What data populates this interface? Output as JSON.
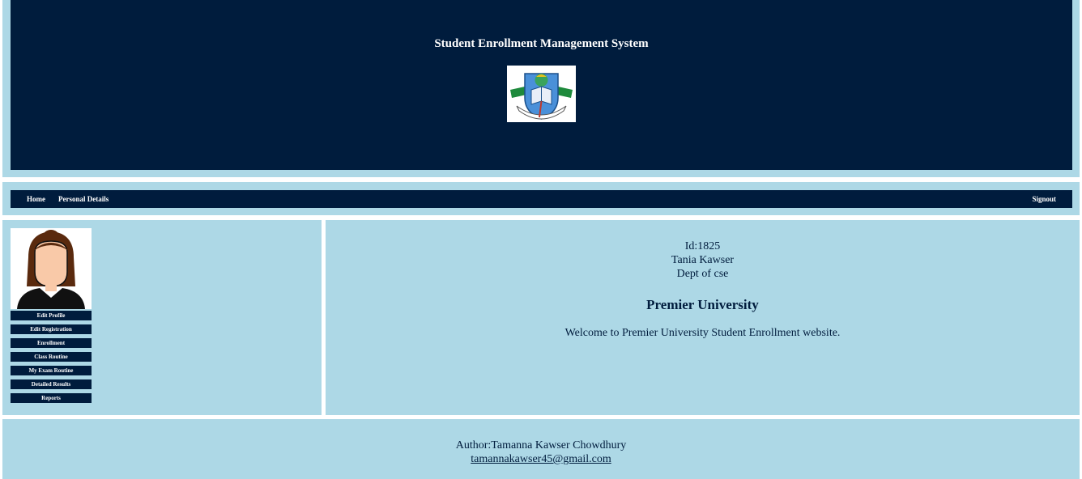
{
  "header": {
    "title": "Student Enrollment Management System",
    "logo_icon": "premier-university-logo",
    "colors": {
      "bg": "#001c3d",
      "page": "#add8e6"
    }
  },
  "nav": {
    "home": "Home",
    "personal": "Personal Details",
    "signout": "Signout"
  },
  "sidebar": {
    "avatar_icon": "female-avatar-icon",
    "items": [
      "Edit Profile",
      "Edit Registration",
      "Enrollment",
      "Class Routine",
      "My Exam Routine",
      "Detailed Results",
      "Reports"
    ]
  },
  "main": {
    "id": "Id:1825",
    "name": "Tania Kawser",
    "dept": "Dept of cse",
    "university": "Premier University",
    "welcome": "Welcome to Premier University Student Enrollment website."
  },
  "footer": {
    "author": "Author:Tamanna Kawser Chowdhury",
    "email": "tamannakawser45@gmail.com"
  }
}
